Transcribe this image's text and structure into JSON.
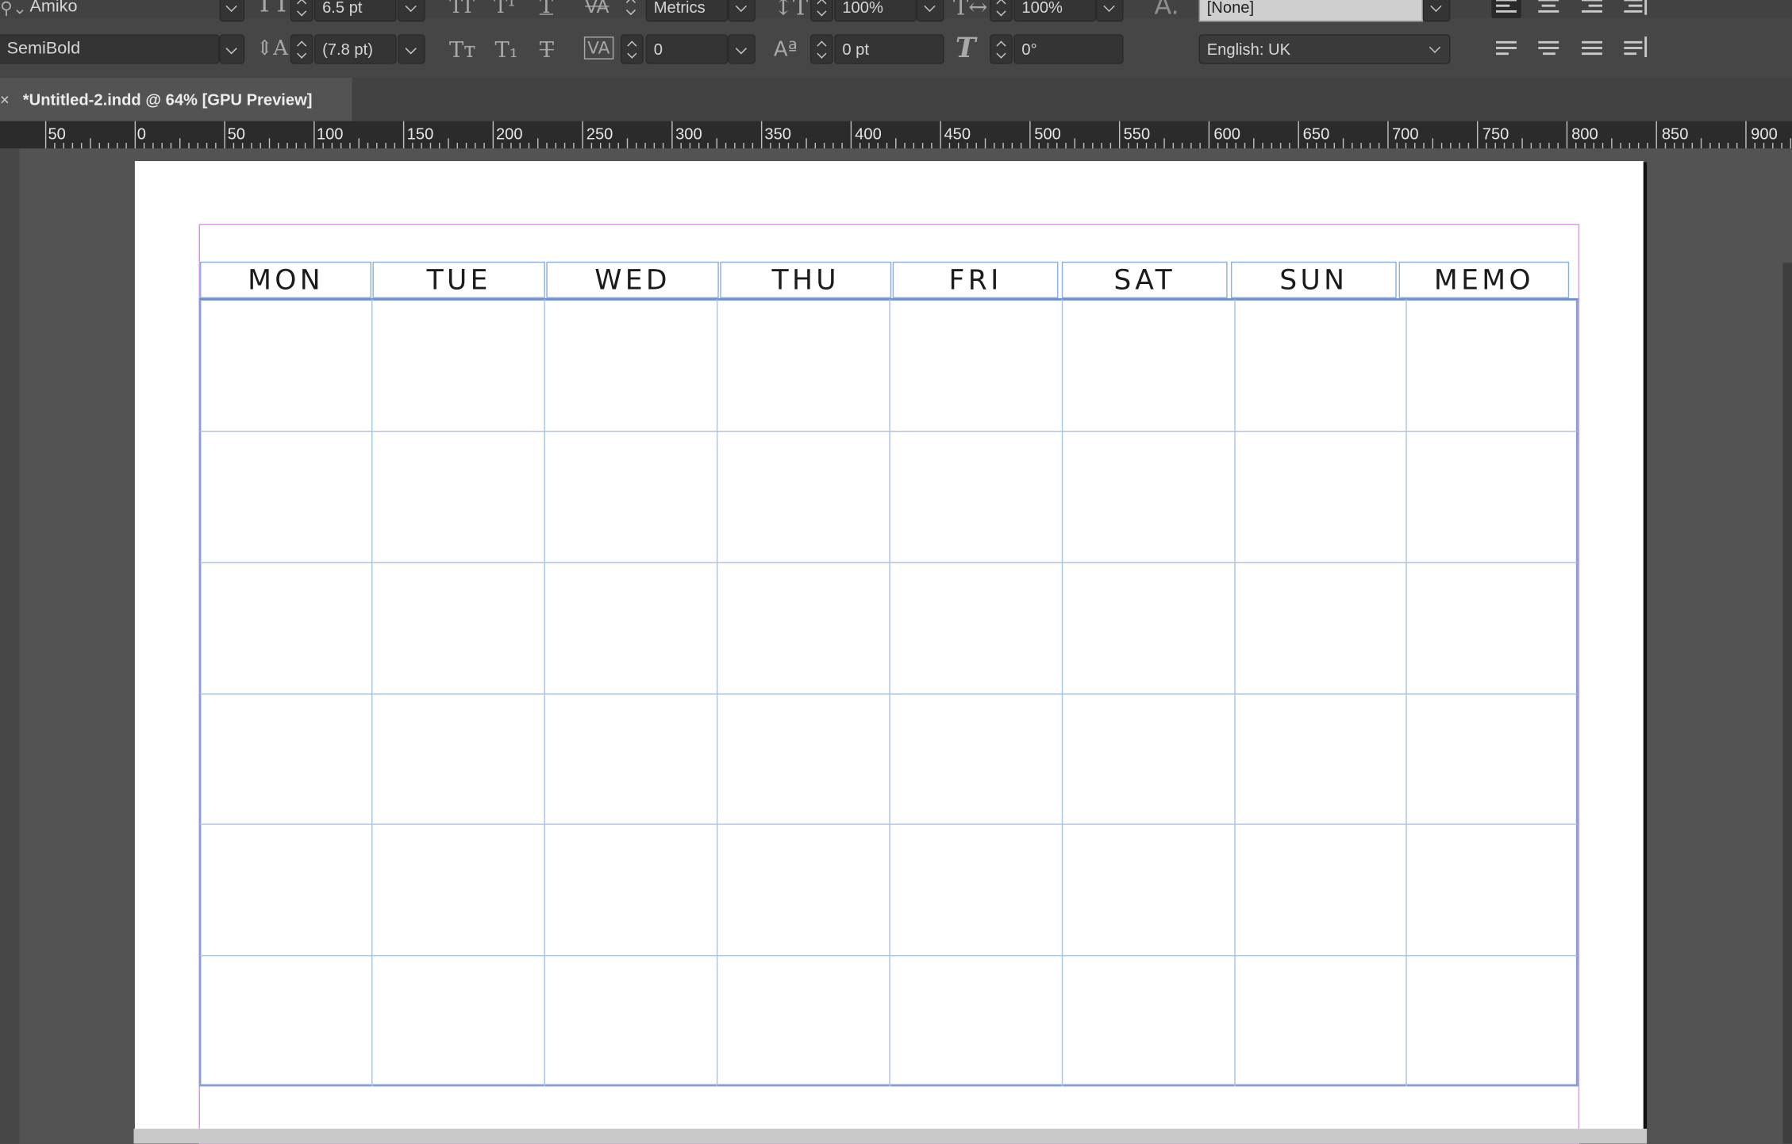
{
  "control_panel": {
    "font_family": "Amiko",
    "font_style": "SemiBold",
    "font_size": "6.5 pt",
    "leading": "(7.8 pt)",
    "kerning": "Metrics",
    "tracking": "0",
    "vertical_scale": "100%",
    "horizontal_scale": "100%",
    "baseline_shift": "0 pt",
    "skew": "0°",
    "character_style": "[None]",
    "language": "English: UK"
  },
  "document_tab": {
    "title": "*Untitled-2.indd @ 64% [GPU Preview]",
    "close_label": "×"
  },
  "ruler": {
    "labels": [
      "50",
      "0",
      "50",
      "100",
      "150",
      "200",
      "250",
      "300",
      "350",
      "400",
      "450",
      "500",
      "550",
      "600",
      "650",
      "700",
      "750",
      "800",
      "850",
      "900"
    ]
  },
  "calendar": {
    "days": [
      "MON",
      "TUE",
      "WED",
      "THU",
      "FRI",
      "SAT",
      "SUN",
      "MEMO"
    ],
    "rows": 6
  },
  "colors": {
    "margin_guide": "#e48cf0",
    "frame_edge": "#8db0dd",
    "table_stroke": "#a9c3e6",
    "pasteboard": "#535353",
    "control_panel": "#464646"
  },
  "icons": {
    "font_size": "font-size-icon",
    "leading": "leading-icon",
    "all_caps": "all-caps-icon",
    "small_caps": "small-caps-icon",
    "superscript": "superscript-icon",
    "subscript": "subscript-icon",
    "underline": "underline-icon",
    "strikethrough": "strikethrough-icon",
    "kerning": "kerning-icon",
    "tracking": "tracking-icon",
    "vertical_scale": "vertical-scale-icon",
    "horizontal_scale": "horizontal-scale-icon",
    "baseline_shift": "baseline-shift-icon",
    "skew": "skew-icon",
    "character_style": "character-style-icon",
    "align": "align-icon"
  }
}
